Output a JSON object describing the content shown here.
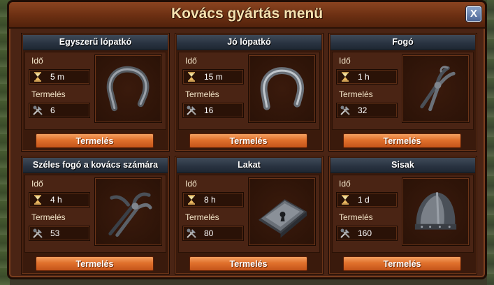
{
  "window": {
    "title": "Kovács gyártás menü",
    "close_label": "X"
  },
  "labels": {
    "time": "Idő",
    "production": "Termelés",
    "button": "Termelés"
  },
  "items": [
    {
      "name": "Egyszerű lópatkó",
      "time": "5 m",
      "amount": "6",
      "image": "horseshoe-icon"
    },
    {
      "name": "Jó lópatkó",
      "time": "15 m",
      "amount": "16",
      "image": "horseshoe-icon"
    },
    {
      "name": "Fogó",
      "time": "1 h",
      "amount": "32",
      "image": "pliers-icon"
    },
    {
      "name": "Széles fogó a kovács számára",
      "time": "4 h",
      "amount": "53",
      "image": "tongs-icon"
    },
    {
      "name": "Lakat",
      "time": "8 h",
      "amount": "80",
      "image": "padlock-icon"
    },
    {
      "name": "Sisak",
      "time": "1 d",
      "amount": "160",
      "image": "helmet-icon"
    }
  ]
}
